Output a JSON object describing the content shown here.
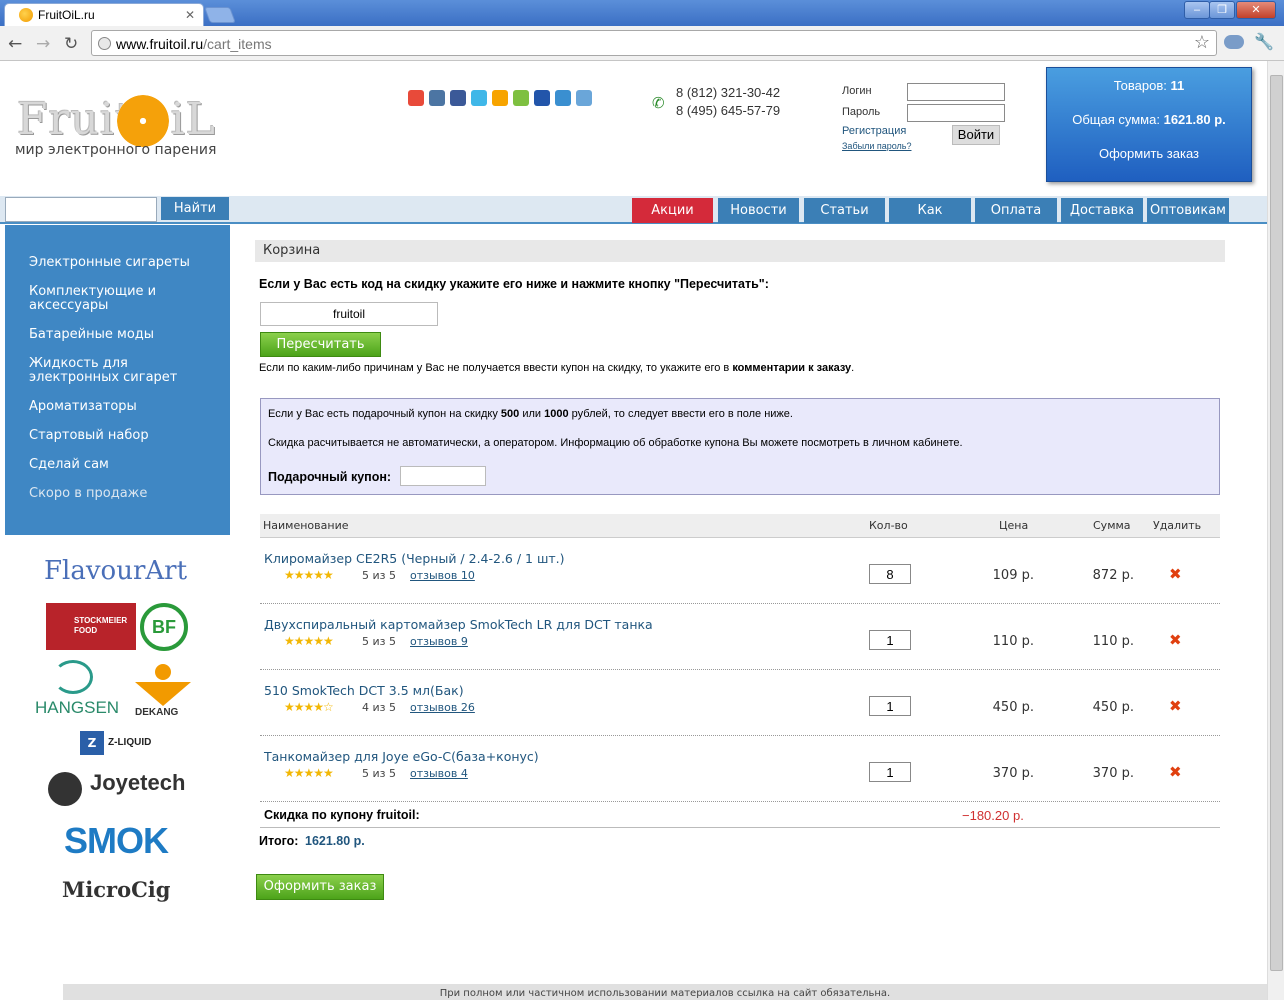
{
  "browser": {
    "tab_title": "FruitOiL.ru",
    "url_host": "www.fruitoil.ru",
    "url_path": "/cart_items",
    "back": "←",
    "forward": "→",
    "reload": "↻",
    "star": "☆",
    "wrench": "🔧"
  },
  "header": {
    "logo_text": "FruitOiL",
    "logo_sub": "мир электронного парения",
    "phones": [
      "8 (812) 321-30-42",
      "8 (495) 645-57-79"
    ],
    "login_label": "Логин",
    "password_label": "Пароль",
    "register": "Регистрация",
    "forgot": "Забыли пароль?",
    "login_button": "Войти"
  },
  "cart_summary": {
    "items_label": "Товаров:",
    "items_count": "11",
    "total_label": "Общая сумма:",
    "total_value": "1621.80 р.",
    "checkout": "Оформить заказ"
  },
  "search": {
    "button": "Найти",
    "value": ""
  },
  "nav": [
    "Акции",
    "Новости",
    "Статьи",
    "Как заказать",
    "Оплата",
    "Доставка",
    "Оптовикам"
  ],
  "sidebar": [
    "Электронные сигареты",
    "Комплектующие и аксессуары",
    "Батарейные моды",
    "Жидкость для электронных сигарет",
    "Ароматизаторы",
    "Стартовый набор",
    "Сделай сам",
    "Скоро в продаже"
  ],
  "brands": [
    "FlavourArt",
    "STOCKMEIER FOOD",
    "BF",
    "HANGSEN",
    "DEKANG",
    "Z-LIQUID",
    "Joyetech",
    "SMOK",
    "MicroCig"
  ],
  "main": {
    "section_title": "Корзина",
    "discount_prompt": "Если у Вас есть код на скидку укажите его ниже и нажмите кнопку \"Пересчитать\":",
    "coupon_value": "fruitoil",
    "recalc_button": "Пересчитать",
    "note_prefix": "Если по каким-либо причинам у Вас не получается ввести купон на скидку, то укажите его в",
    "note_bold": "комментарии к заказу",
    "note_suffix": ".",
    "info_line1_a": "Если у Вас есть подарочный купон на скидку",
    "info_line1_b": "500",
    "info_line1_c": "или",
    "info_line1_d": "1000",
    "info_line1_e": "рублей, то следует ввести его в поле ниже.",
    "info_line2": "Скидка расчитывается не автоматически, а оператором. Информацию об обработке купона Вы можете посмотреть в личном кабинете.",
    "gift_label": "Подарочный купон:",
    "gift_value": ""
  },
  "table": {
    "headers": {
      "name": "Наименование",
      "qty": "Кол-во",
      "price": "Цена",
      "sum": "Сумма",
      "delete": "Удалить"
    },
    "rows": [
      {
        "name": "Клиромайзер CE2R5 (Черный / 2.4-2.6 / 1 шт.)",
        "stars": "★★★★★",
        "rating": "5 из 5",
        "reviews": "отзывов 10",
        "qty": "8",
        "price": "109 р.",
        "sum": "872 р."
      },
      {
        "name": "Двухспиральный картомайзер SmokTech LR для DCT танка",
        "stars": "★★★★★",
        "rating": "5 из 5",
        "reviews": "отзывов 9",
        "qty": "1",
        "price": "110 р.",
        "sum": "110 р."
      },
      {
        "name": "510 SmokTech DCT 3.5 мл(Бак)",
        "stars": "★★★★☆",
        "rating": "4 из 5",
        "reviews": "отзывов 26",
        "qty": "1",
        "price": "450 р.",
        "sum": "450 р."
      },
      {
        "name": "Танкомайзер для Joye eGo-C(база+конус)",
        "stars": "★★★★★",
        "rating": "5 из 5",
        "reviews": "отзывов 4",
        "qty": "1",
        "price": "370 р.",
        "sum": "370 р."
      }
    ],
    "discount_label": "Скидка по купону fruitoil:",
    "discount_value": "−180.20 р.",
    "total_label": "Итого:",
    "total_value": "1621.80 р.",
    "checkout": "Оформить заказ",
    "delete_icon": "✖"
  },
  "footer": "При полном или частичном использовании материалов ссылка на сайт обязательна."
}
